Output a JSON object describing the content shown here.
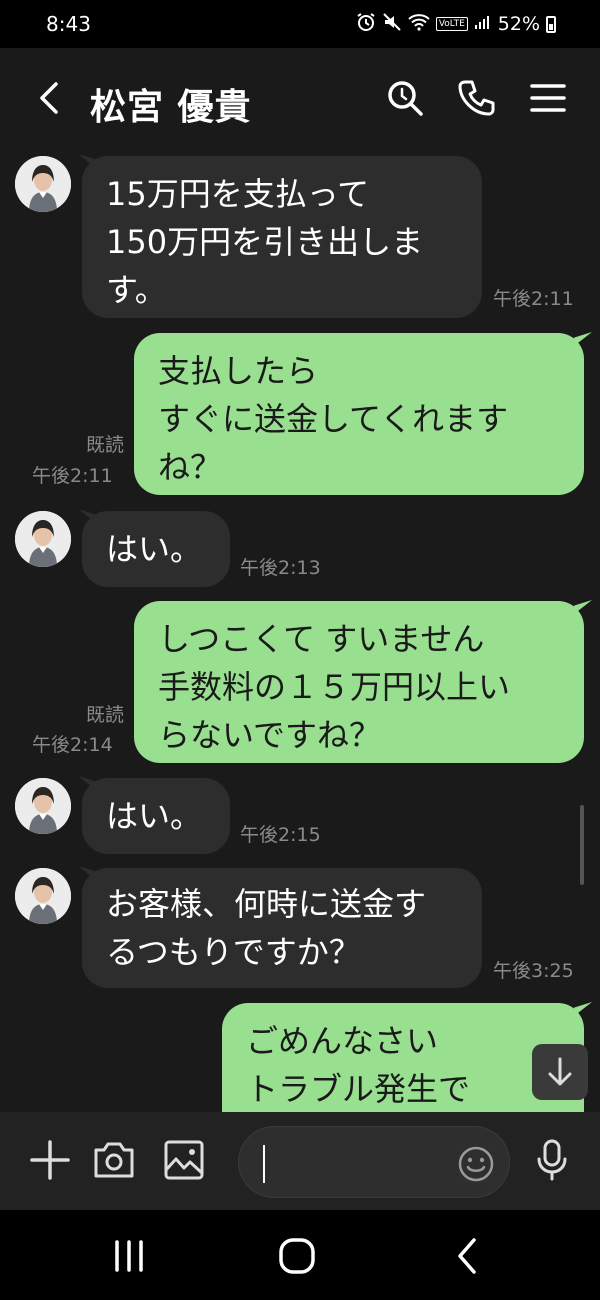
{
  "status": {
    "time": "8:43",
    "volte": "VoLTE",
    "battery_pct": "52%"
  },
  "header": {
    "title": "松宮 優貴",
    "icons": [
      "back-icon",
      "search-icon",
      "phone-icon",
      "menu-icon"
    ]
  },
  "messages": [
    {
      "dir": "in",
      "lines": [
        "15万円を支払って",
        "150万円を引き出しま",
        "す。"
      ],
      "time": "午後2:11"
    },
    {
      "dir": "out",
      "lines": [
        "支払したら",
        "すぐに送金してくれます",
        "ね？"
      ],
      "read": "既読",
      "time": "午後2:11"
    },
    {
      "dir": "in",
      "lines": [
        "はい。"
      ],
      "time": "午後2:13"
    },
    {
      "dir": "out",
      "lines": [
        "しつこくて すいません",
        "手数料の１５万円以上い",
        "らないですね？"
      ],
      "read": "既読",
      "time": "午後2:14"
    },
    {
      "dir": "in",
      "lines": [
        "はい。"
      ],
      "time": "午後2:15"
    },
    {
      "dir": "in",
      "lines": [
        "お客様、何時に送金す",
        "るつもりですか？"
      ],
      "time": "午後3:25"
    },
    {
      "dir": "out",
      "lines": [
        "ごめんなさい",
        "トラブル発生で"
      ]
    }
  ],
  "input": {
    "placeholder": "",
    "icons": [
      "plus-icon",
      "camera-icon",
      "image-icon",
      "emoji-icon",
      "mic-icon"
    ]
  },
  "colors": {
    "background": "#1a1a1a",
    "incoming_bubble": "#2d2d2d",
    "outgoing_bubble": "#98df8f",
    "timestamp": "#8a8a8a"
  }
}
